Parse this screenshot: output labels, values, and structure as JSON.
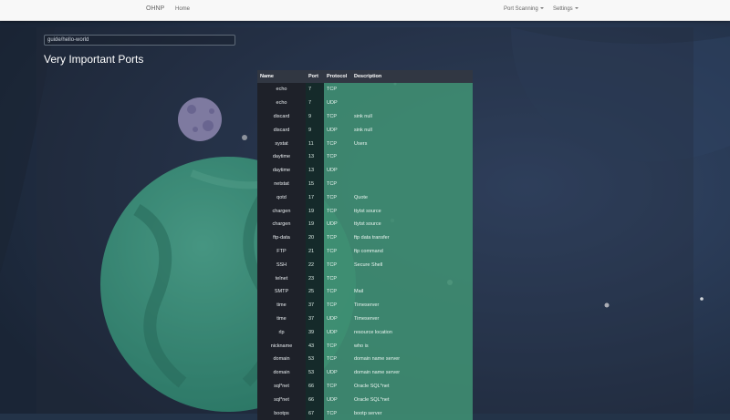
{
  "navbar": {
    "brand": "OHNP",
    "home": "Home",
    "port_scanning": "Port Scanning",
    "settings": "Settings"
  },
  "search": {
    "value": "guide/hello-world"
  },
  "page": {
    "title": "Very Important Ports"
  },
  "table": {
    "headers": [
      "Name",
      "Port",
      "Protocol",
      "Description"
    ],
    "rows": [
      [
        "echo",
        "7",
        "TCP",
        ""
      ],
      [
        "echo",
        "7",
        "UDP",
        ""
      ],
      [
        "discard",
        "9",
        "TCP",
        "sink null"
      ],
      [
        "discard",
        "9",
        "UDP",
        "sink null"
      ],
      [
        "systat",
        "11",
        "TCP",
        "Users"
      ],
      [
        "daytime",
        "13",
        "TCP",
        ""
      ],
      [
        "daytime",
        "13",
        "UDP",
        ""
      ],
      [
        "netstat",
        "15",
        "TCP",
        ""
      ],
      [
        "qotd",
        "17",
        "TCP",
        "Quote"
      ],
      [
        "chargen",
        "19",
        "TCP",
        "ttytst source"
      ],
      [
        "chargen",
        "19",
        "UDP",
        "ttytst source"
      ],
      [
        "ftp-data",
        "20",
        "TCP",
        "ftp data transfer"
      ],
      [
        "FTP",
        "21",
        "TCP",
        "ftp command"
      ],
      [
        "SSH",
        "22",
        "TCP",
        "Secure Shell"
      ],
      [
        "telnet",
        "23",
        "TCP",
        ""
      ],
      [
        "SMTP",
        "25",
        "TCP",
        "Mail"
      ],
      [
        "time",
        "37",
        "TCP",
        "Timeserver"
      ],
      [
        "time",
        "37",
        "UDP",
        "Timeserver"
      ],
      [
        "rlp",
        "39",
        "UDP",
        "resource location"
      ],
      [
        "nickname",
        "43",
        "TCP",
        "who is"
      ],
      [
        "domain",
        "53",
        "TCP",
        "domain name server"
      ],
      [
        "domain",
        "53",
        "UDP",
        "domain name server"
      ],
      [
        "sql*net",
        "66",
        "TCP",
        "Oracle SQL*net"
      ],
      [
        "sql*net",
        "66",
        "UDP",
        "Oracle SQL*net"
      ],
      [
        "bootps",
        "67",
        "TCP",
        "bootp server"
      ]
    ]
  },
  "colors": {
    "background": "#233348",
    "planet": "#3fae8d",
    "moon": "#a99fd0",
    "table_accent": "#409173",
    "navbar": "#f8f8f8"
  }
}
